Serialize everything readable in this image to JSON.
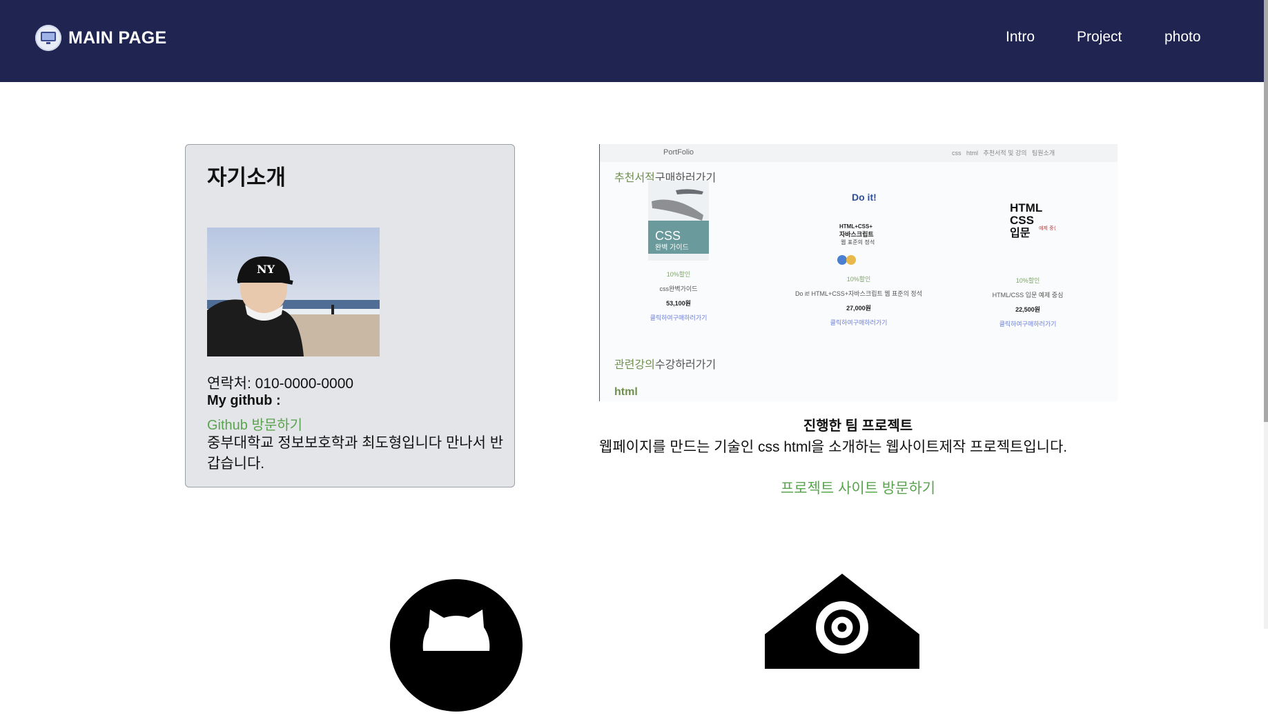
{
  "header": {
    "brand_title": "MAIN PAGE",
    "nav": [
      "Intro",
      "Project",
      "photo"
    ],
    "background": "#1f2451"
  },
  "intro": {
    "title": "자기소개",
    "contact": "연락처: 010-0000-0000",
    "github_label": "My github :",
    "github_link": "Github 방문하기",
    "bio": "중부대학교 정보보호학과 최도형입니다 만나서 반갑습니다."
  },
  "project": {
    "preview": {
      "brand": "PortFolio",
      "menu": [
        "css",
        "html",
        "추천서적 및 강의",
        "팀원소개"
      ],
      "books_section": "추천서적",
      "books_section_suffix": "구매하러가기",
      "books": [
        {
          "cover_title": "CSS",
          "cover_subtitle": "완벽 가이드",
          "discount": "10%할인",
          "name": "css완벽가이드",
          "price": "53,100원",
          "link": "클릭하여구매하러가기"
        },
        {
          "cover_title": "Do it!",
          "cover_subtitle": "HTML+CSS+자바스크립트 웹 표준의 정석",
          "discount": "10%할인",
          "name": "Do it! HTML+CSS+자바스크립트 웹 표준의 정석",
          "price": "27,000원",
          "link": "클릭하여구매하러가기"
        },
        {
          "cover_title": "HTML CSS 입문",
          "cover_subtitle": "예제 중심",
          "discount": "10%할인",
          "name": "HTML/CSS 입문 예제 중심",
          "price": "22,500원",
          "link": "클릭하여구매하러가기"
        }
      ],
      "lecture_section": "관련강의",
      "lecture_section_suffix": "수강하러가기",
      "html_label": "html"
    },
    "heading": "진행한 팀 프로젝트",
    "description": "웹페이지를 만드는 기술인 css html을 소개하는 웹사이트제작 프로젝트입니다.",
    "link": "프로젝트 사이트 방문하기"
  },
  "icons": [
    "github-icon",
    "mail-icon"
  ],
  "colors": {
    "link": "#5aa34f",
    "card": "#e4e5e9"
  }
}
